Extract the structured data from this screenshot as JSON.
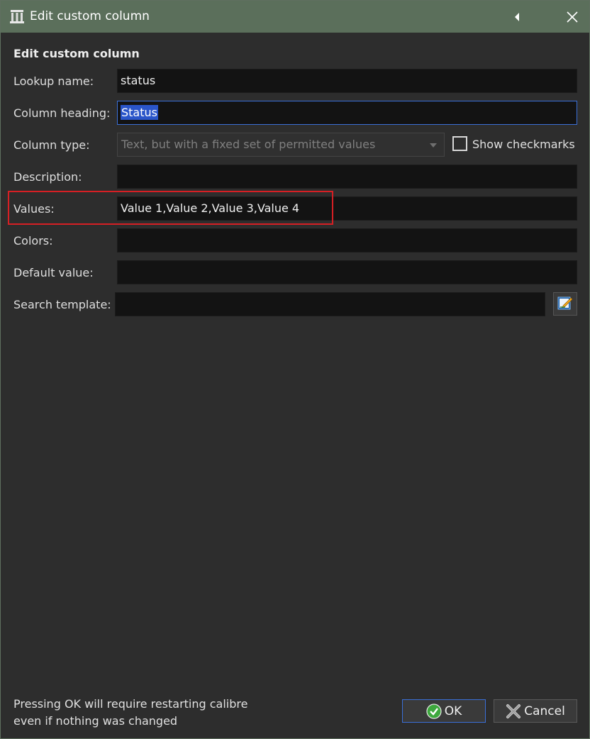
{
  "window": {
    "title": "Edit custom column"
  },
  "section_title": "Edit custom column",
  "fields": {
    "lookup_name": {
      "label": "Lookup name:",
      "value": "status"
    },
    "column_heading": {
      "label": "Column heading:",
      "value": "Status"
    },
    "column_type": {
      "label": "Column type:",
      "value": "Text, but with a fixed set of permitted values"
    },
    "show_checkmarks": {
      "label": "Show checkmarks",
      "checked": false
    },
    "description": {
      "label": "Description:",
      "value": ""
    },
    "values": {
      "label": "Values:",
      "value": "Value 1,Value 2,Value 3,Value 4"
    },
    "colors": {
      "label": "Colors:",
      "value": ""
    },
    "default_value": {
      "label": "Default value:",
      "value": ""
    },
    "search_template": {
      "label": "Search template:",
      "value": ""
    }
  },
  "footer": {
    "message_line1": "Pressing OK will require restarting calibre",
    "message_line2": "even if nothing was changed",
    "ok_label": "OK",
    "cancel_label": "Cancel"
  },
  "colors": {
    "titlebar": "#5b6f5b",
    "background": "#2d2d2d",
    "highlight_box": "#d61f24",
    "focus_border": "#3a6fd8"
  },
  "icons": {
    "app": "calibre-library-icon",
    "back": "caret-left-icon",
    "close": "close-icon",
    "edit_template": "edit-pencil-icon",
    "ok": "green-check-icon",
    "cancel": "x-icon"
  }
}
